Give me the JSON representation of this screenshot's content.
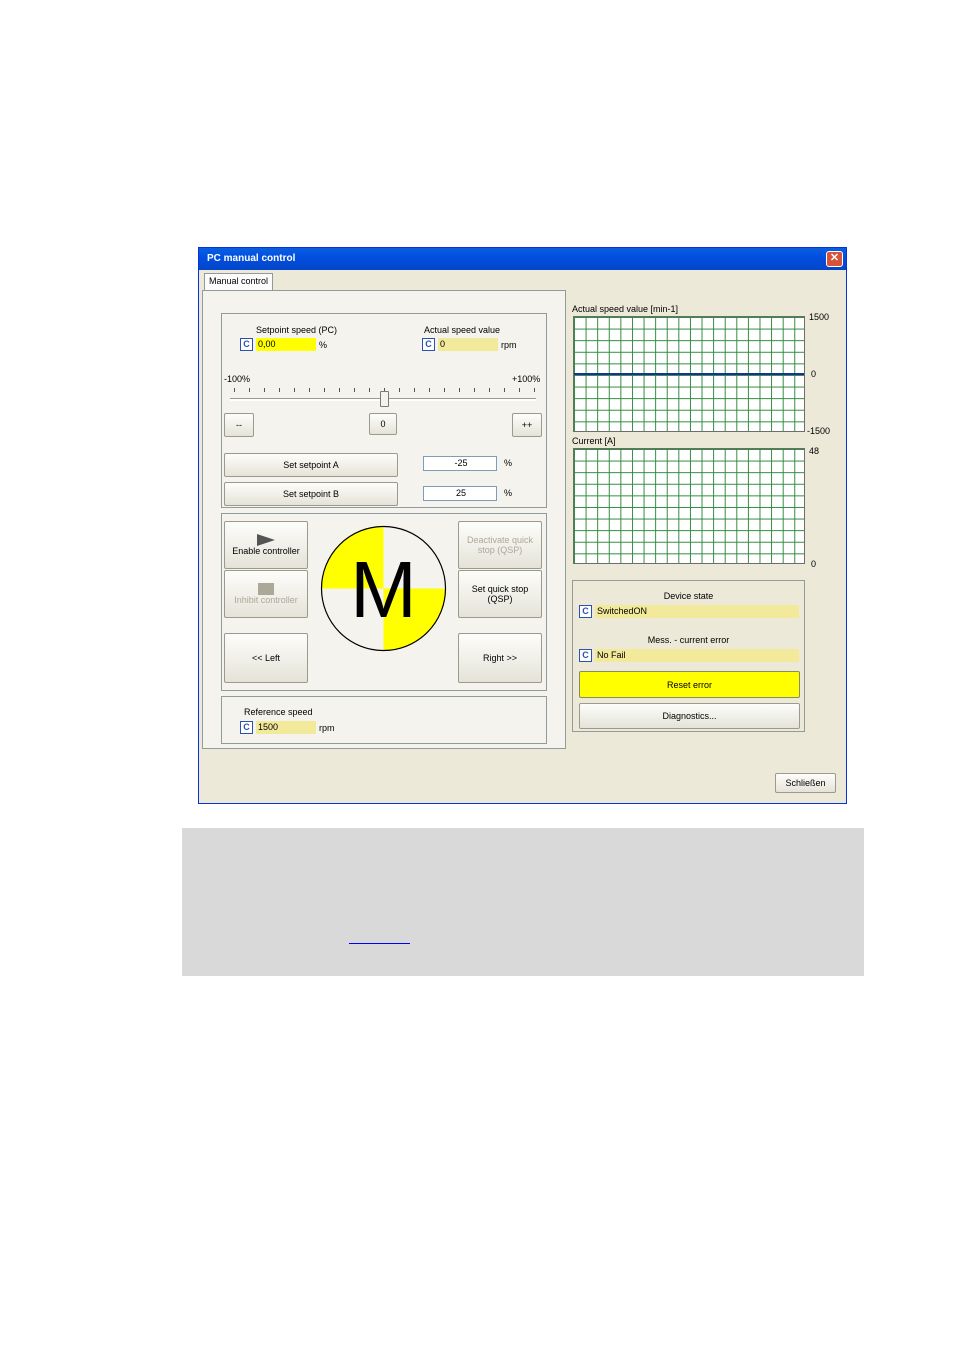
{
  "window": {
    "title": "PC manual control",
    "close_glyph": "✕"
  },
  "tabs": [
    {
      "label": "Manual control"
    }
  ],
  "speed": {
    "setpoint_label": "Setpoint speed (PC)",
    "setpoint_value": "0,00",
    "setpoint_unit": "%",
    "actual_label": "Actual speed value",
    "actual_value": "0",
    "actual_unit": "rpm",
    "slider_min_label": "-100%",
    "slider_max_label": "+100%",
    "slider_value_percent": 0,
    "minus_label": "--",
    "zero_label": "0",
    "plus_label": "++",
    "setpoint_a_label": "Set setpoint A",
    "setpoint_a_value": "-25",
    "setpoint_a_unit": "%",
    "setpoint_b_label": "Set setpoint B",
    "setpoint_b_value": "25",
    "setpoint_b_unit": "%"
  },
  "controls": {
    "enable_label": "Enable controller",
    "inhibit_label": "Inhibit controller",
    "deactivate_qsp_label": "Deactivate quick stop (QSP)",
    "set_qsp_label": "Set quick stop (QSP)",
    "left_label": "<< Left",
    "right_label": "Right >>",
    "motor_letter": "M"
  },
  "reference": {
    "label": "Reference speed",
    "value": "1500",
    "unit": "rpm"
  },
  "charts": {
    "speed_title": "Actual speed value [min-1]",
    "speed_max": "1500",
    "speed_mid": "0",
    "speed_min": "-1500",
    "current_title": "Current [A]",
    "current_max": "48",
    "current_min": "0"
  },
  "status": {
    "device_state_label": "Device state",
    "device_state_value": "SwitchedON",
    "error_label": "Mess. - current error",
    "error_value": "No Fail",
    "reset_label": "Reset error",
    "diagnostics_label": "Diagnostics..."
  },
  "c_marker": "C",
  "footer": {
    "close_label": "Schließen"
  },
  "colors": {
    "accent_yellow": "#ffff00",
    "title_blue": "#0050e0",
    "grid_green": "#2e8a3e",
    "speed_line": "#1a2f9c"
  },
  "chart_data": [
    {
      "type": "line",
      "title": "Actual speed value [min-1]",
      "ylim": [
        -1500,
        1500
      ],
      "yticks": [
        "1500",
        "0",
        "-1500"
      ],
      "grid": true,
      "series": [
        {
          "values": [
            0,
            0,
            0,
            0,
            0,
            0,
            0,
            0,
            0,
            0,
            0,
            0,
            0,
            0,
            0,
            0,
            0,
            0,
            0,
            0
          ]
        }
      ]
    },
    {
      "type": "line",
      "title": "Current [A]",
      "ylim": [
        0,
        48
      ],
      "yticks": [
        "48",
        "0"
      ],
      "grid": true,
      "series": []
    }
  ]
}
